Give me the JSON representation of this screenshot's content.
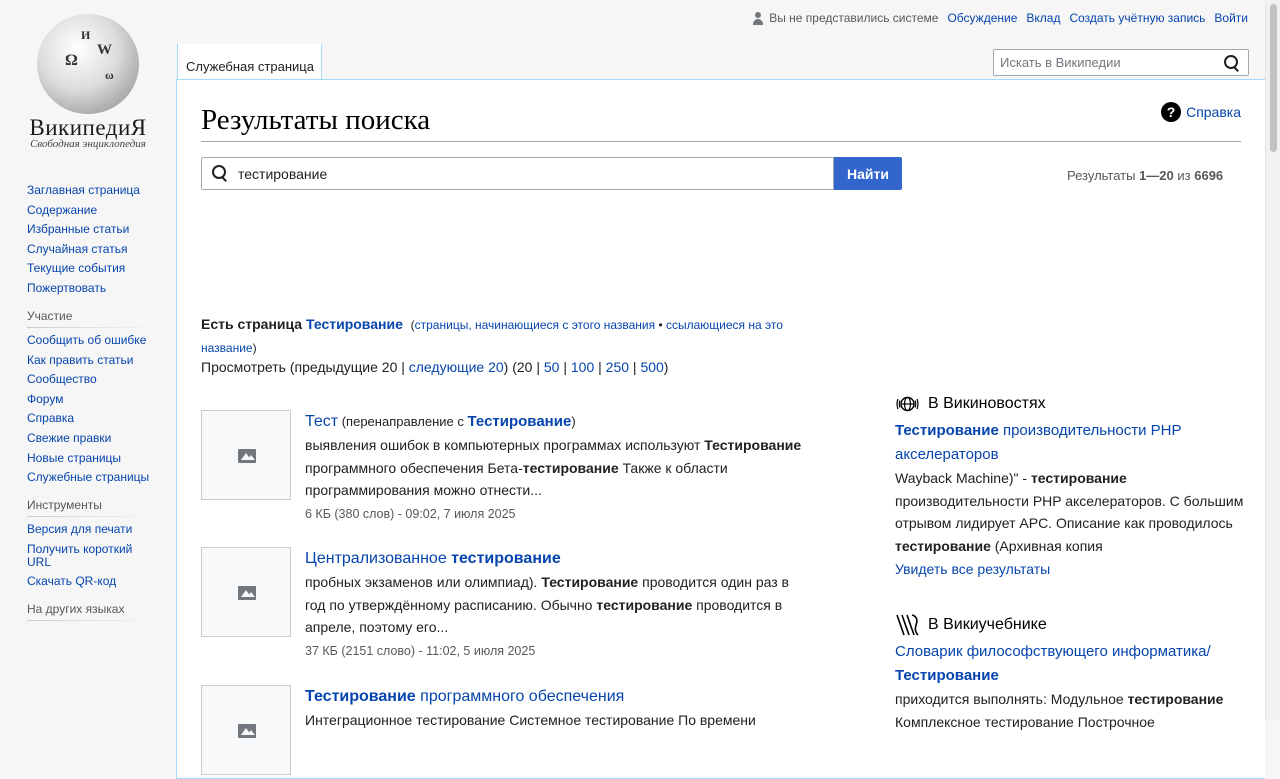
{
  "logo": {
    "wordmark": "ВикипедиЯ",
    "tagline": "Свободная энциклопедия"
  },
  "sidebar": {
    "nav": [
      "Заглавная страница",
      "Содержание",
      "Избранные статьи",
      "Случайная статья",
      "Текущие события",
      "Пожертвовать"
    ],
    "participation": {
      "heading": "Участие",
      "items": [
        "Сообщить об ошибке",
        "Как править статьи",
        "Сообщество",
        "Форум",
        "Справка",
        "Свежие правки",
        "Новые страницы",
        "Служебные страницы"
      ]
    },
    "tools": {
      "heading": "Инструменты",
      "items": [
        "Версия для печати",
        "Получить короткий URL",
        "Скачать QR-код"
      ]
    },
    "languages": {
      "heading": "На других языках"
    }
  },
  "personal": {
    "anon": "Вы не представились системе",
    "talk": "Обсуждение",
    "contribs": "Вклад",
    "create": "Создать учётную запись",
    "login": "Войти"
  },
  "tabs": {
    "special": "Служебная страница"
  },
  "header_search": {
    "placeholder": "Искать в Википедии"
  },
  "page": {
    "title": "Результаты поиска",
    "help": "Справка"
  },
  "search": {
    "query": "тестирование",
    "button": "Найти",
    "results_prefix": "Результаты ",
    "results_range": "1—20",
    "results_of": " из ",
    "results_total": "6696"
  },
  "suggest": {
    "prefix": "Есть страница ",
    "page": "Тестирование",
    "open_paren": "(",
    "link1": "страницы, начинающиеся с этого названия",
    "sep": " • ",
    "link2": "ссылающиеся на это название",
    "close_paren": ")"
  },
  "paging": {
    "label": "Просмотреть (предыдущие 20 | ",
    "next": "следующие 20",
    "mid": ") (20 | ",
    "l50": "50",
    "l100": "100",
    "l250": "250",
    "l500": "500",
    "pipe": " | ",
    "end": ")"
  },
  "results": [
    {
      "title": "Тест",
      "redir_prefix": " (перенаправление с ",
      "redir_target": "Тестирование",
      "redir_suffix": ")",
      "snippet": [
        {
          "t": "выявления ошибок в компьютерных программах используют ",
          "b": false
        },
        {
          "t": "Тестирование",
          "b": true
        },
        {
          "t": " программного обеспечения Бета-",
          "b": false
        },
        {
          "t": "тестирование",
          "b": true
        },
        {
          "t": " Также к области программирования можно отнести...",
          "b": false
        }
      ],
      "meta": "6 КБ (380 слов) - 09:02, 7 июля 2025"
    },
    {
      "title_plain": "Централизованное ",
      "title_bold": "тестирование",
      "snippet": [
        {
          "t": "пробных экзаменов или олимпиад). ",
          "b": false
        },
        {
          "t": "Тестирование",
          "b": true
        },
        {
          "t": " проводится один раз в год по утверждённому расписанию. Обычно ",
          "b": false
        },
        {
          "t": "тестирование",
          "b": true
        },
        {
          "t": " проводится в апреле, поэтому его...",
          "b": false
        }
      ],
      "meta": "37 КБ (2151 слово) - 11:02, 5 июля 2025"
    },
    {
      "title_bold": "Тестирование",
      "title_plain": " программного обеспечения",
      "snippet_partial": "Интеграционное тестирование Системное тестирование По времени"
    }
  ],
  "sister": [
    {
      "heading": "В Викиновостях",
      "title_bold": "Тестирование",
      "title_plain": " производительности PHP акселераторов",
      "snippet": [
        {
          "t": "Wayback Machine)\" - ",
          "b": false
        },
        {
          "t": "тестирование",
          "b": true
        },
        {
          "t": " производительности PHP акселераторов. С большим отрывом лидирует APC. Описание как проводилось ",
          "b": false
        },
        {
          "t": "тестирование",
          "b": true
        },
        {
          "t": " (Архивная копия",
          "b": false
        }
      ],
      "see_all": "Увидеть все результаты"
    },
    {
      "heading": "В Викиучебнике",
      "title_plain": "Словарик философствующего информатика/",
      "title_bold": "Тестирование",
      "snippet": [
        {
          "t": "приходится выполнять: Модульное ",
          "b": false
        },
        {
          "t": "тестирование",
          "b": true
        },
        {
          "t": " Комплексное тестирование Построчное",
          "b": false
        }
      ]
    }
  ],
  "colors": {
    "link": "#0645ad",
    "progressive": "#3366cc",
    "border": "#a7d7f9"
  }
}
